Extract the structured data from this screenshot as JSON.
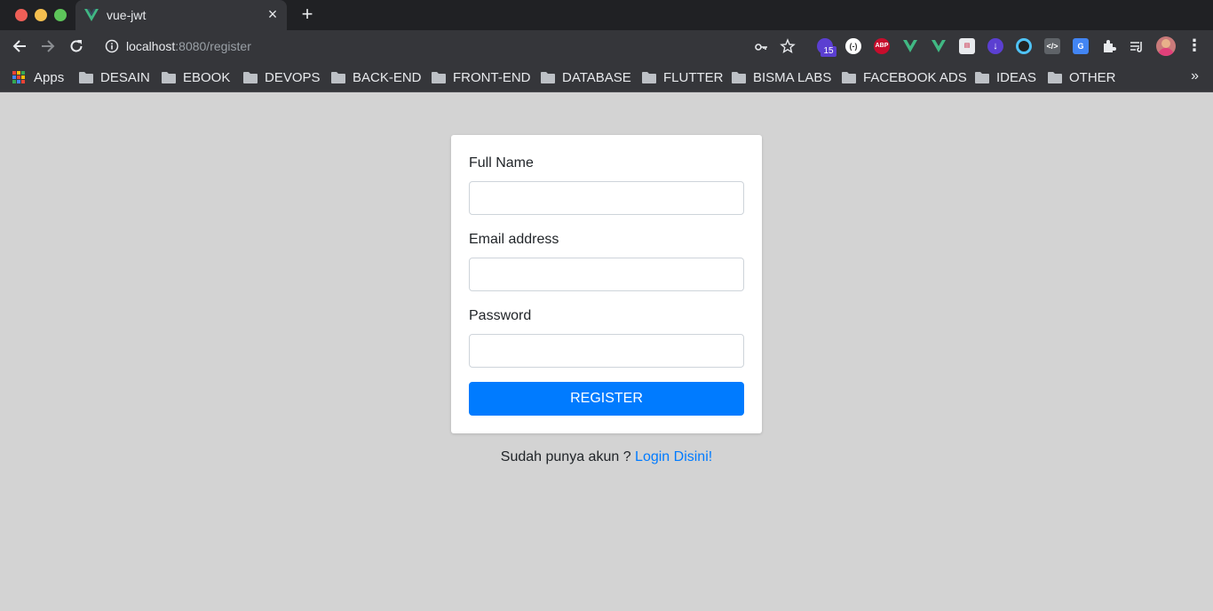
{
  "browser": {
    "tab_title": "vue-jwt",
    "url_host": "localhost",
    "url_path": ":8080/register",
    "extensions": [
      {
        "name": "extension-1-icon",
        "color": "#5b3fd1",
        "badge": "15"
      },
      {
        "name": "extension-2-icon",
        "color": "#ffffff"
      },
      {
        "name": "adblock-plus-icon",
        "color": "#c70d2c",
        "text": "ABP"
      },
      {
        "name": "vue-devtools-icon",
        "color": "#41b883"
      },
      {
        "name": "vue-devtools-2-icon",
        "color": "#41b883"
      },
      {
        "name": "extension-6-icon",
        "color": "#e8eaed"
      },
      {
        "name": "download-icon",
        "color": "#5b3fd1"
      },
      {
        "name": "extension-8-icon",
        "color": "#4fc3f7"
      },
      {
        "name": "code-icon",
        "color": "#9aa0a6"
      },
      {
        "name": "translate-icon",
        "color": "#4285f4"
      },
      {
        "name": "puzzle-icon",
        "color": "#e8eaed"
      },
      {
        "name": "reading-list-icon",
        "color": "#e8eaed"
      }
    ],
    "bookmarks": {
      "apps_label": "Apps",
      "items": [
        {
          "label": "DESAIN"
        },
        {
          "label": "EBOOK"
        },
        {
          "label": "DEVOPS"
        },
        {
          "label": "BACK-END"
        },
        {
          "label": "FRONT-END"
        },
        {
          "label": "DATABASE"
        },
        {
          "label": "FLUTTER"
        },
        {
          "label": "BISMA LABS"
        },
        {
          "label": "FACEBOOK ADS"
        },
        {
          "label": "IDEAS"
        },
        {
          "label": "OTHER"
        }
      ],
      "more_label": "»"
    }
  },
  "form": {
    "full_name_label": "Full Name",
    "full_name_value": "",
    "email_label": "Email address",
    "email_value": "",
    "password_label": "Password",
    "password_value": "",
    "register_label": "REGISTER"
  },
  "footer": {
    "prompt": "Sudah punya akun ?",
    "login_link": "Login Disini!"
  },
  "colors": {
    "primary": "#007bff",
    "page_background": "#d3d3d3",
    "chrome_dark": "#35363a"
  }
}
